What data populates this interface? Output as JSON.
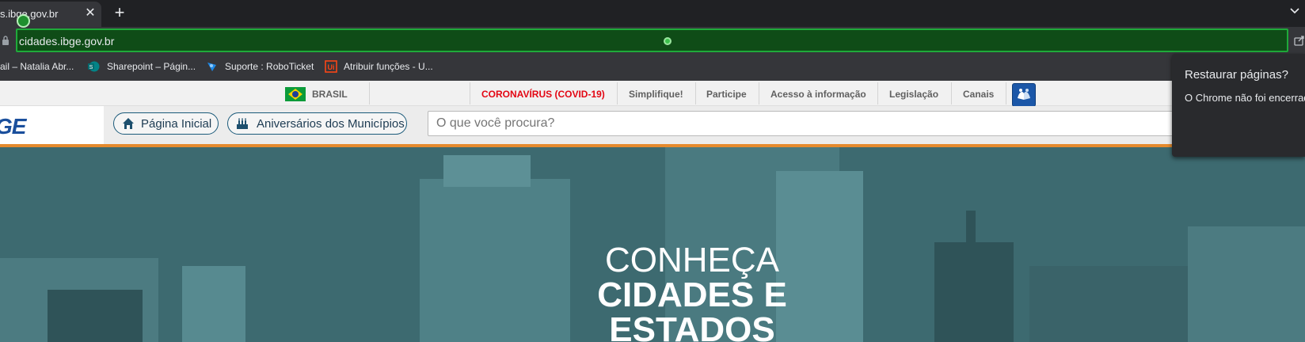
{
  "browser": {
    "tab": {
      "title": "s.ibge.gov.br",
      "close_glyph": "✕",
      "favicon": "green-check-icon"
    },
    "new_tab_glyph": "+",
    "address_bar": {
      "url": "cidades.ibge.gov.br",
      "accent": "#1faa3a"
    },
    "bookmarks": [
      {
        "label": "ail – Natalia Abr...",
        "icon": "mail-icon"
      },
      {
        "label": "Sharepoint – Págin...",
        "icon": "sharepoint-icon"
      },
      {
        "label": "Suporte : RoboTicket",
        "icon": "roboticket-icon"
      },
      {
        "label": "Atribuir funções - U...",
        "icon": "uipath-icon"
      }
    ],
    "restore_popup": {
      "title": "Restaurar páginas?",
      "body": "O Chrome não foi encerrado"
    }
  },
  "gov_bar": {
    "country": "BRASIL",
    "links": [
      {
        "label": "CORONAVÍRUS (COVID-19)",
        "color": "#e30613"
      },
      {
        "label": "Simplifique!"
      },
      {
        "label": "Participe"
      },
      {
        "label": "Acesso à informação"
      },
      {
        "label": "Legislação"
      },
      {
        "label": "Canais"
      }
    ]
  },
  "header": {
    "logo": "GE",
    "nav": [
      {
        "label": "Página Inicial",
        "icon": "home-icon"
      },
      {
        "label": "Aniversários dos Municípios",
        "icon": "cake-icon"
      }
    ],
    "search": {
      "placeholder": "O que você procura?"
    }
  },
  "hero": {
    "line1": "CONHEÇA",
    "line2": "CIDADES E",
    "line3": "ESTADOS"
  },
  "colors": {
    "orange_rule": "#e58a2d",
    "hero_bg": "#3d6a70",
    "brand_blue": "#1a4f9c"
  }
}
